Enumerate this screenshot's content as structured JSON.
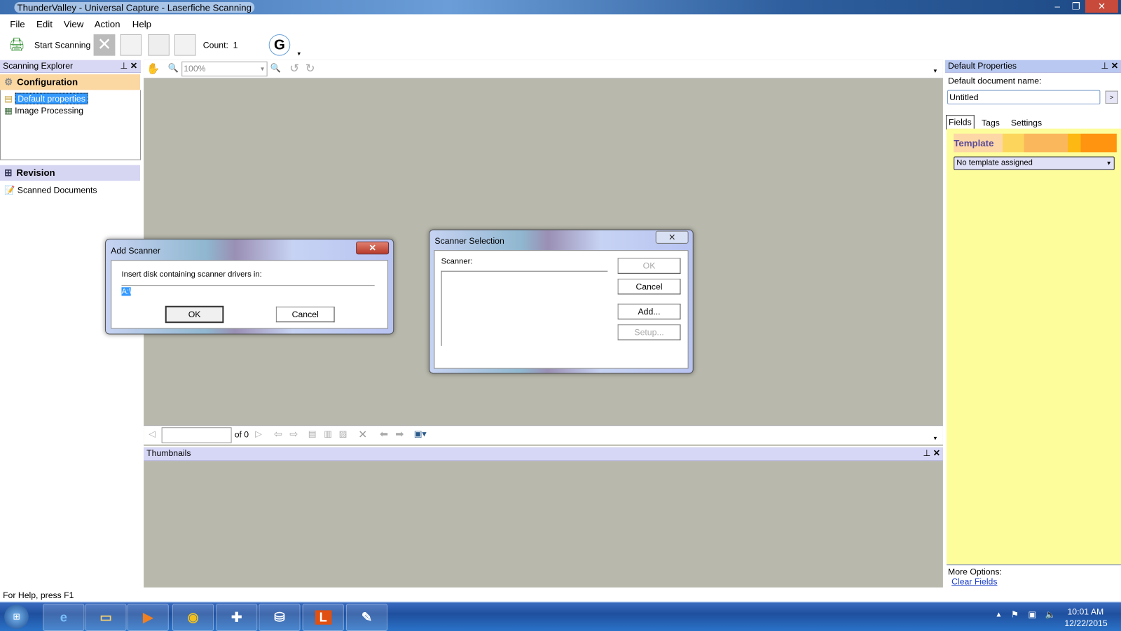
{
  "window": {
    "title": "ThunderValley - Universal Capture - Laserfiche Scanning"
  },
  "menu": [
    "File",
    "Edit",
    "View",
    "Action",
    "Help"
  ],
  "toolbar": {
    "start_scanning": "Start Scanning",
    "count_label": "Count:",
    "count_value": "1"
  },
  "explorer": {
    "title": "Scanning Explorer",
    "configuration": "Configuration",
    "items": [
      "Default properties",
      "Image Processing"
    ],
    "revision": "Revision",
    "revision_items": [
      "Scanned Documents"
    ]
  },
  "viewer": {
    "zoom": "100%",
    "of_pages": "of 0",
    "page_value": ""
  },
  "thumbnails": {
    "title": "Thumbnails"
  },
  "properties": {
    "title": "Default Properties",
    "doc_name_label": "Default document name:",
    "doc_name_value": "Untitled",
    "arrow_btn": ">",
    "tabs": [
      "Fields",
      "Tags",
      "Settings"
    ],
    "template_label": "Template",
    "template_value": "No template assigned",
    "more_options": "More Options:",
    "clear_fields": "Clear Fields"
  },
  "add_scanner": {
    "title": "Add Scanner",
    "prompt": "Insert disk containing scanner drivers in:",
    "path": "A:\\",
    "ok": "OK",
    "cancel": "Cancel"
  },
  "scanner_selection": {
    "title": "Scanner Selection",
    "scanner_label": "Scanner:",
    "ok": "OK",
    "cancel": "Cancel",
    "add": "Add...",
    "setup": "Setup..."
  },
  "status": {
    "help": "For Help, press F1"
  },
  "taskbar": {
    "time": "10:01 AM",
    "date": "12/22/2015",
    "laserfiche_letter": "L"
  }
}
